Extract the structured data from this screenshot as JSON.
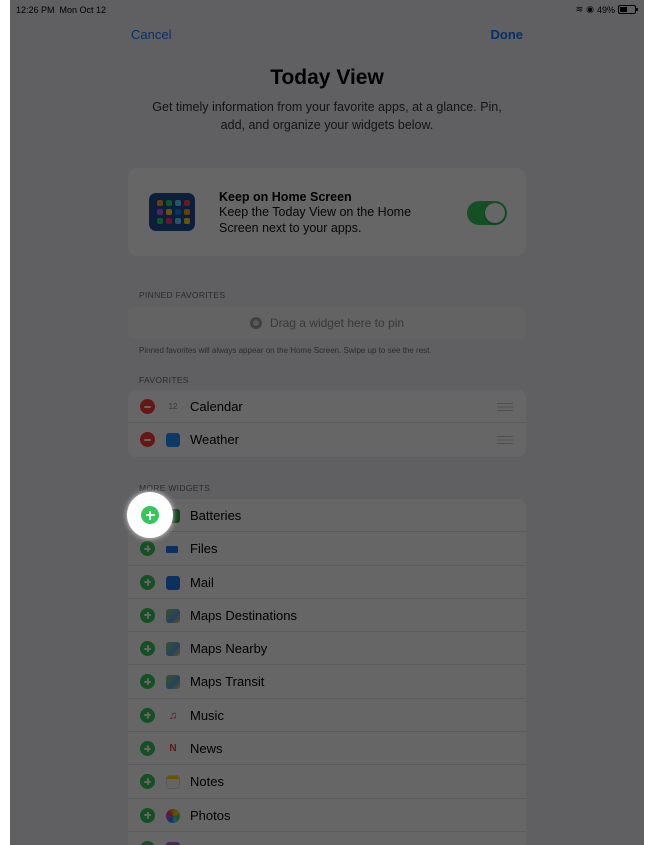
{
  "status": {
    "time": "12:26 PM",
    "date": "Mon Oct 12",
    "battery": "49%"
  },
  "nav": {
    "cancel": "Cancel",
    "done": "Done"
  },
  "header": {
    "title": "Today View",
    "subtitle": "Get timely information from your favorite apps, at a glance. Pin, add, and organize your widgets below."
  },
  "home_screen": {
    "title": "Keep on Home Screen",
    "description": "Keep the Today View on the Home Screen next to your apps.",
    "toggle_on": true
  },
  "pinned": {
    "header": "PINNED FAVORITES",
    "placeholder": "Drag a widget here to pin",
    "footnote": "Pinned favorites will always appear on the Home Screen. Swipe up to see the rest."
  },
  "favorites": {
    "header": "FAVORITES",
    "items": [
      {
        "label": "Calendar",
        "icon": "calendar-icon",
        "icon_text": "12"
      },
      {
        "label": "Weather",
        "icon": "weather-icon"
      }
    ]
  },
  "more_widgets": {
    "header": "MORE WIDGETS",
    "items": [
      {
        "label": "Batteries",
        "icon": "batteries-icon"
      },
      {
        "label": "Files",
        "icon": "files-icon"
      },
      {
        "label": "Mail",
        "icon": "mail-icon"
      },
      {
        "label": "Maps Destinations",
        "icon": "maps-icon"
      },
      {
        "label": "Maps Nearby",
        "icon": "maps-icon"
      },
      {
        "label": "Maps Transit",
        "icon": "maps-icon"
      },
      {
        "label": "Music",
        "icon": "music-icon",
        "icon_text": "♫"
      },
      {
        "label": "News",
        "icon": "news-icon",
        "icon_text": "N"
      },
      {
        "label": "Notes",
        "icon": "notes-icon"
      },
      {
        "label": "Photos",
        "icon": "photos-icon"
      }
    ]
  },
  "colors": {
    "accent": "#0a7aff",
    "add": "#34c759",
    "remove": "#ff3b30",
    "toggle": "#34c759"
  }
}
